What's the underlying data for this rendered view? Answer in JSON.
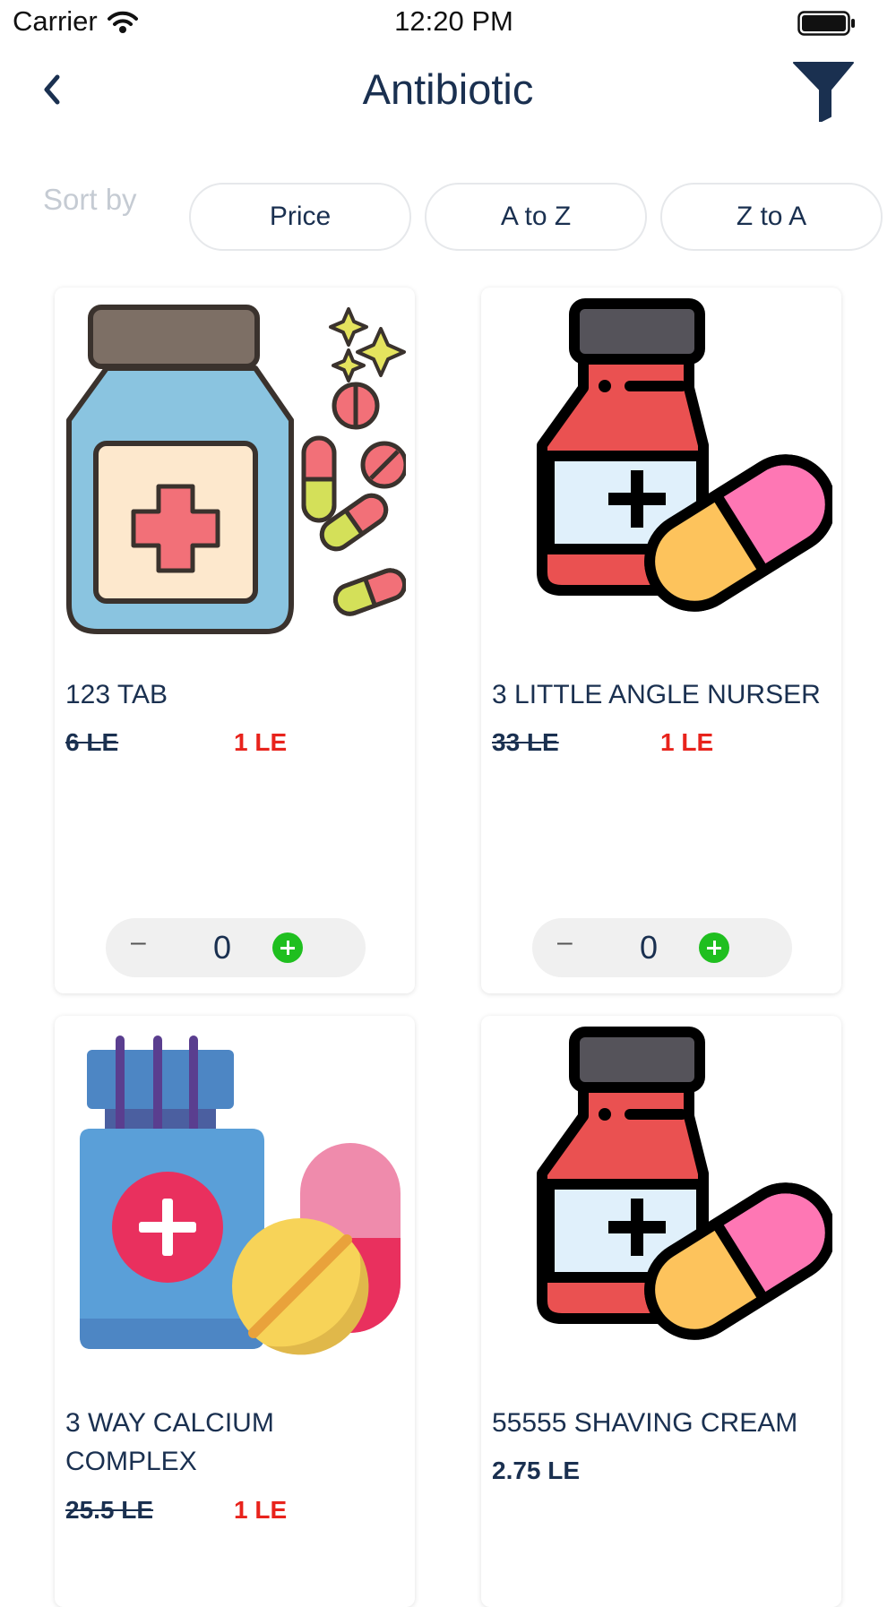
{
  "status": {
    "carrier": "Carrier",
    "time": "12:20 PM"
  },
  "header": {
    "title": "Antibiotic"
  },
  "sort": {
    "label": "Sort by",
    "options": [
      "Price",
      "A to Z",
      "Z to A"
    ]
  },
  "products": [
    {
      "name": "123 TAB",
      "old_price": "6 LE",
      "price": "1 LE",
      "qty": "0",
      "minus": "–",
      "image": "medicine-bottle-pills-icon"
    },
    {
      "name": "3 LITTLE ANGLE NURSER",
      "old_price": "33 LE",
      "price": "1 LE",
      "qty": "0",
      "minus": "–",
      "image": "medicine-bottle-capsule-icon"
    },
    {
      "name": "3 WAY CALCIUM COMPLEX",
      "old_price": "25.5 LE",
      "price": "1 LE",
      "image": "vitamin-bottle-pills-icon"
    },
    {
      "name": "55555 SHAVING CREAM",
      "price": "2.75 LE",
      "image": "medicine-bottle-capsule-icon"
    }
  ],
  "colors": {
    "title": "#1a3050",
    "sale_price": "#e8231c",
    "add_button": "#1fbf1f",
    "sort_label": "#c5cbd3"
  }
}
